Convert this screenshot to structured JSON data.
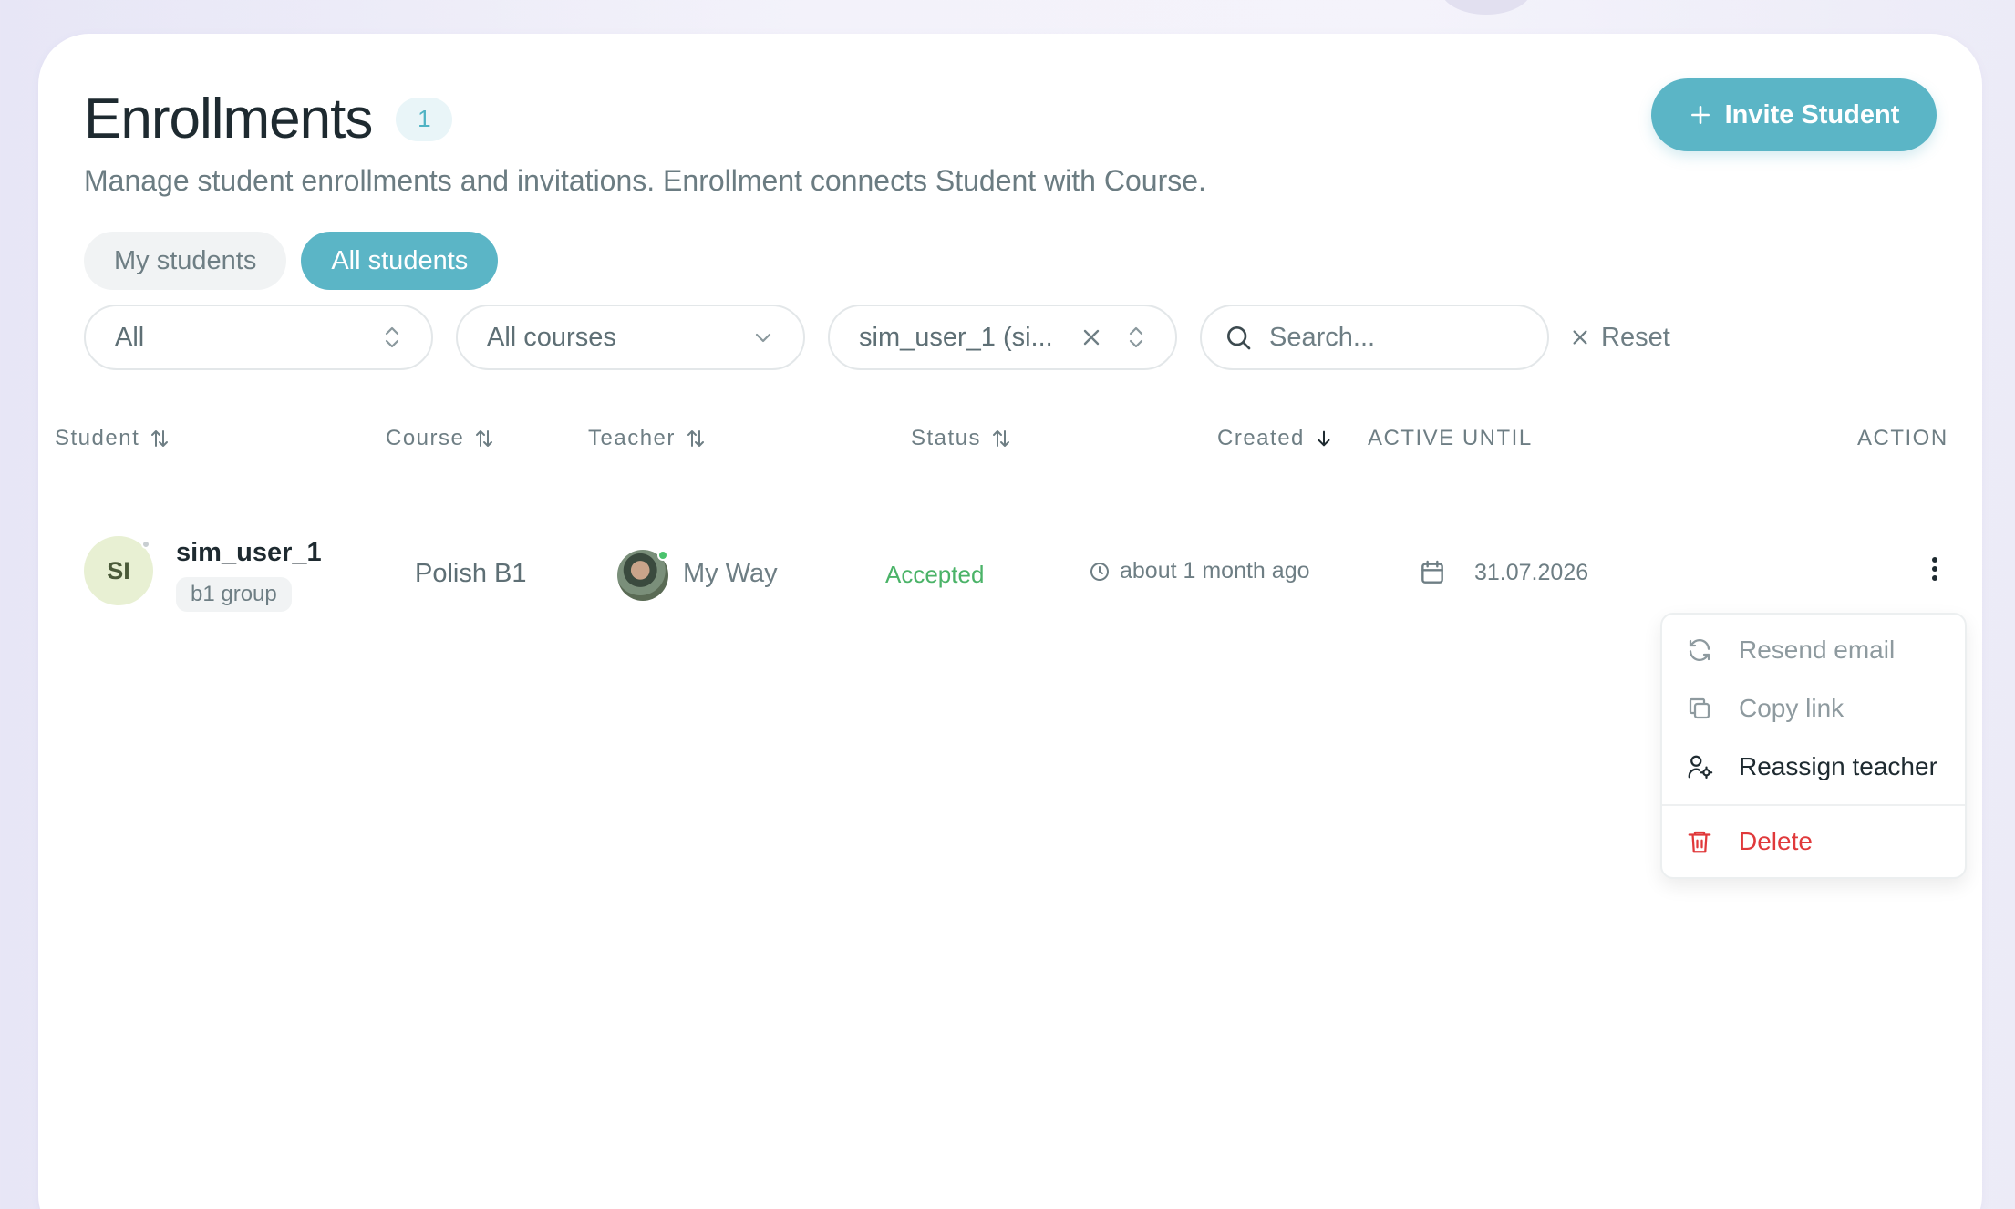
{
  "header": {
    "title": "Enrollments",
    "count": "1",
    "subtitle": "Manage student enrollments and invitations. Enrollment connects Student with Course.",
    "invite_label": "Invite Student"
  },
  "tabs": [
    {
      "label": "My students",
      "active": false
    },
    {
      "label": "All students",
      "active": true
    }
  ],
  "filters": {
    "status_value": "All",
    "course_value": "All courses",
    "student_value": "sim_user_1 (si...",
    "search_placeholder": "Search...",
    "reset_label": "Reset"
  },
  "table": {
    "columns": [
      "Student",
      "Course",
      "Teacher",
      "Status",
      "Created",
      "ACTIVE UNTIL",
      "ACTION"
    ],
    "rows": [
      {
        "avatar_initials": "SI",
        "student": "sim_user_1",
        "group": "b1 group",
        "course": "Polish B1",
        "teacher": "My Way",
        "status": "Accepted",
        "created": "about 1 month ago",
        "active_until": "31.07.2026"
      }
    ]
  },
  "action_menu": {
    "items": [
      {
        "label": "Resend email",
        "icon": "refresh-icon",
        "state": "disabled"
      },
      {
        "label": "Copy link",
        "icon": "copy-icon",
        "state": "disabled"
      },
      {
        "label": "Reassign teacher",
        "icon": "user-cog-icon",
        "state": "normal"
      },
      {
        "label": "Delete",
        "icon": "trash-icon",
        "state": "danger"
      }
    ]
  },
  "colors": {
    "accent": "#5bb5c6",
    "status_accepted": "#4bb368",
    "danger": "#e0393b"
  }
}
